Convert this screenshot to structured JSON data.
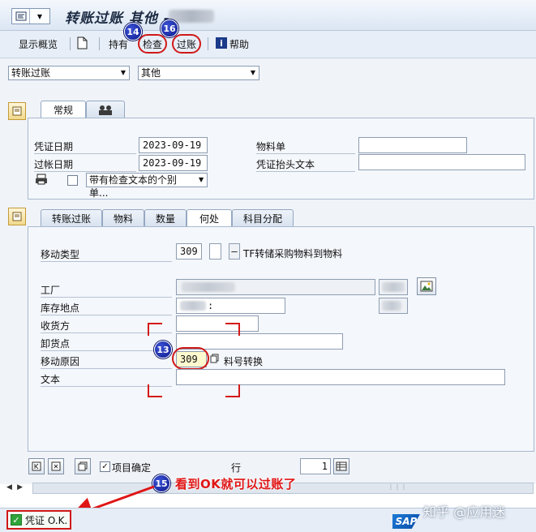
{
  "window": {
    "title": "转账过账 其他 -"
  },
  "toolbar": {
    "display_overview": "显示概览",
    "hold": "持有",
    "check": "检查",
    "post": "过账",
    "help": "帮助"
  },
  "header_selectors": {
    "transaction": "转账过账",
    "reference": "其他"
  },
  "header_tabs": {
    "general": "常规"
  },
  "header_fields": {
    "doc_date_label": "凭证日期",
    "doc_date": "2023-09-19",
    "posting_date_label": "过帐日期",
    "posting_date": "2023-09-19",
    "material_slip_label": "物料单",
    "material_slip": "",
    "header_text_label": "凭证抬头文本",
    "header_text": "",
    "print_option": "带有检查文本的个别单..."
  },
  "item_tabs": [
    "转账过账",
    "物料",
    "数量",
    "何处",
    "科目分配"
  ],
  "item_fields": {
    "movement_type_label": "移动类型",
    "movement_type": "309",
    "movement_type_text": "TF转储采购物料到物料",
    "plant_label": "工厂",
    "storage_location_label": "库存地点",
    "storage_location_suffix": ":",
    "recipient_label": "收货方",
    "recipient": "",
    "unloading_point_label": "卸货点",
    "unloading_point": "",
    "reason_label": "移动原因",
    "reason": "309",
    "reason_text": "料号转换",
    "text_label": "文本",
    "text": ""
  },
  "bottom": {
    "item_ok": "项目确定",
    "row_label": "行",
    "row_value": "1"
  },
  "status": {
    "message": "凭证 O.K."
  },
  "annotations": {
    "badge_13": "13",
    "badge_14": "14",
    "badge_15": "15",
    "badge_16": "16",
    "note": "看到OK就可以过账了"
  },
  "branding": {
    "sap": "SAP",
    "watermark": "知乎 @应用迷"
  }
}
